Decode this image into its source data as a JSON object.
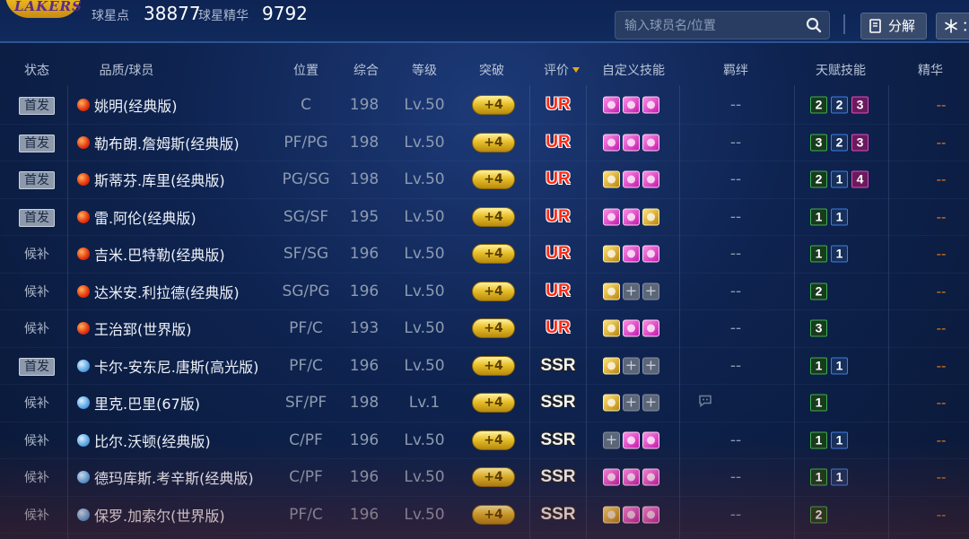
{
  "header": {
    "logo_text": "LAKERS",
    "points_label": "球星点",
    "points_value": "38877",
    "essence_label": "球星精华",
    "essence_value": "9792",
    "search_placeholder": "输入球员名/位置",
    "decompose_label": "分解",
    "second_button_label": "："
  },
  "columns": [
    "状态",
    "品质/球员",
    "位置",
    "综合",
    "等级",
    "突破",
    "评价",
    "自定义技能",
    "羁绊",
    "天赋技能",
    "精华"
  ],
  "colors": {
    "ur": "#ff2a16",
    "accent": "#e9a51b",
    "essence_dash": "#e07a1e"
  },
  "players": [
    {
      "status": "首发",
      "starter": true,
      "quality": "red",
      "name": "姚明(经典版)",
      "position": "C",
      "overall": "198",
      "level": "Lv.50",
      "breakthrough": "+4",
      "rating": "UR",
      "skills": [
        "pink",
        "pink",
        "pink"
      ],
      "bond": "--",
      "bond_icon": false,
      "talents": [
        [
          "2",
          "g"
        ],
        [
          "2",
          "b"
        ],
        [
          "3",
          "p"
        ]
      ],
      "essence": "--"
    },
    {
      "status": "首发",
      "starter": true,
      "quality": "red",
      "name": "勒布朗.詹姆斯(经典版)",
      "position": "PF/PG",
      "overall": "198",
      "level": "Lv.50",
      "breakthrough": "+4",
      "rating": "UR",
      "skills": [
        "pink",
        "pink",
        "pink"
      ],
      "bond": "--",
      "bond_icon": false,
      "talents": [
        [
          "3",
          "g"
        ],
        [
          "2",
          "b"
        ],
        [
          "3",
          "p"
        ]
      ],
      "essence": "--"
    },
    {
      "status": "首发",
      "starter": true,
      "quality": "red",
      "name": "斯蒂芬.库里(经典版)",
      "position": "PG/SG",
      "overall": "198",
      "level": "Lv.50",
      "breakthrough": "+4",
      "rating": "UR",
      "skills": [
        "gold",
        "pink",
        "pink"
      ],
      "bond": "--",
      "bond_icon": false,
      "talents": [
        [
          "2",
          "g"
        ],
        [
          "1",
          "b"
        ],
        [
          "4",
          "p"
        ]
      ],
      "essence": "--"
    },
    {
      "status": "首发",
      "starter": true,
      "quality": "red",
      "name": "雷.阿伦(经典版)",
      "position": "SG/SF",
      "overall": "195",
      "level": "Lv.50",
      "breakthrough": "+4",
      "rating": "UR",
      "skills": [
        "pink",
        "pink",
        "gold"
      ],
      "bond": "--",
      "bond_icon": false,
      "talents": [
        [
          "1",
          "g"
        ],
        [
          "1",
          "b"
        ]
      ],
      "essence": "--"
    },
    {
      "status": "候补",
      "starter": false,
      "quality": "red",
      "name": "吉米.巴特勒(经典版)",
      "position": "SF/SG",
      "overall": "196",
      "level": "Lv.50",
      "breakthrough": "+4",
      "rating": "UR",
      "skills": [
        "gold",
        "pink",
        "pink"
      ],
      "bond": "--",
      "bond_icon": false,
      "talents": [
        [
          "1",
          "g"
        ],
        [
          "1",
          "b"
        ]
      ],
      "essence": "--"
    },
    {
      "status": "候补",
      "starter": false,
      "quality": "red",
      "name": "达米安.利拉德(经典版)",
      "position": "SG/PG",
      "overall": "196",
      "level": "Lv.50",
      "breakthrough": "+4",
      "rating": "UR",
      "skills": [
        "gold",
        "empty",
        "empty"
      ],
      "bond": "--",
      "bond_icon": false,
      "talents": [
        [
          "2",
          "g"
        ]
      ],
      "essence": "--"
    },
    {
      "status": "候补",
      "starter": false,
      "quality": "red",
      "name": "王治郅(世界版)",
      "position": "PF/C",
      "overall": "193",
      "level": "Lv.50",
      "breakthrough": "+4",
      "rating": "UR",
      "skills": [
        "gold",
        "pink",
        "pink"
      ],
      "bond": "--",
      "bond_icon": false,
      "talents": [
        [
          "3",
          "g"
        ]
      ],
      "essence": "--"
    },
    {
      "status": "首发",
      "starter": true,
      "quality": "blue",
      "name": "卡尔-安东尼.唐斯(高光版)",
      "position": "PF/C",
      "overall": "196",
      "level": "Lv.50",
      "breakthrough": "+4",
      "rating": "SSR",
      "skills": [
        "gold",
        "empty",
        "empty"
      ],
      "bond": "--",
      "bond_icon": false,
      "talents": [
        [
          "1",
          "g"
        ],
        [
          "1",
          "b"
        ]
      ],
      "essence": "--"
    },
    {
      "status": "候补",
      "starter": false,
      "quality": "blue",
      "name": "里克.巴里(67版)",
      "position": "SF/PF",
      "overall": "198",
      "level": "Lv.1",
      "breakthrough": "+4",
      "rating": "SSR",
      "skills": [
        "gold",
        "empty",
        "empty"
      ],
      "bond": "",
      "bond_icon": true,
      "talents": [
        [
          "1",
          "g"
        ]
      ],
      "essence": "--"
    },
    {
      "status": "候补",
      "starter": false,
      "quality": "blue",
      "name": "比尔.沃顿(经典版)",
      "position": "C/PF",
      "overall": "196",
      "level": "Lv.50",
      "breakthrough": "+4",
      "rating": "SSR",
      "skills": [
        "empty",
        "pink",
        "pink"
      ],
      "bond": "--",
      "bond_icon": false,
      "talents": [
        [
          "1",
          "g"
        ],
        [
          "1",
          "b"
        ]
      ],
      "essence": "--"
    },
    {
      "status": "候补",
      "starter": false,
      "quality": "blue",
      "name": "德玛库斯.考辛斯(经典版)",
      "position": "C/PF",
      "overall": "196",
      "level": "Lv.50",
      "breakthrough": "+4",
      "rating": "SSR",
      "skills": [
        "pink",
        "pink",
        "pink"
      ],
      "bond": "--",
      "bond_icon": false,
      "talents": [
        [
          "1",
          "g"
        ],
        [
          "1",
          "b"
        ]
      ],
      "essence": "--"
    },
    {
      "status": "候补",
      "starter": false,
      "quality": "blue",
      "name": "保罗.加索尔(世界版)",
      "position": "PF/C",
      "overall": "196",
      "level": "Lv.50",
      "breakthrough": "+4",
      "rating": "SSR",
      "skills": [
        "gold",
        "pink",
        "pink"
      ],
      "bond": "--",
      "bond_icon": false,
      "talents": [
        [
          "2",
          "g"
        ]
      ],
      "essence": "--"
    }
  ]
}
